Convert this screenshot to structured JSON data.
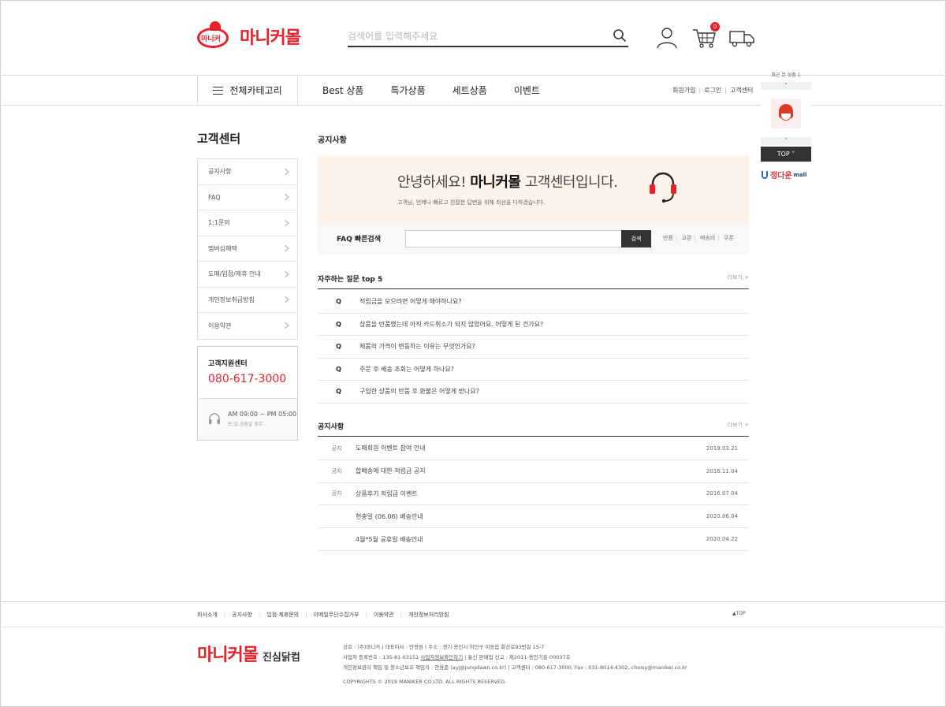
{
  "header": {
    "logo_small": "마니커",
    "logo_text": "마니커몰",
    "search_placeholder": "검색어를 입력해주세요",
    "cart_count": "0"
  },
  "nav": {
    "all_category": "전체카테고리",
    "menu": [
      "Best 상품",
      "특가상품",
      "세트상품",
      "이벤트"
    ],
    "util": [
      "회원가입",
      "로그인",
      "고객센터"
    ]
  },
  "sidebar": {
    "title": "고객센터",
    "items": [
      "공지사항",
      "FAQ",
      "1:1문의",
      "멤버십혜택",
      "도매/입점/제휴 안내",
      "개인정보취급방침",
      "이용약관"
    ],
    "cs_title": "고객지원센터",
    "cs_phone": "080-617-3000",
    "cs_hours": "AM 09:00 ~ PM 05:00",
    "cs_holiday": "토,일,공휴일 휴무"
  },
  "main": {
    "title": "공지사항",
    "banner_prefix": "안녕하세요! ",
    "banner_brand": "마니커몰",
    "banner_suffix": " 고객센터입니다.",
    "banner_desc": "고객님, 언제나 빠르고 친절한 답변을 위해 최선을 다하겠습니다.",
    "faq_search_label": "FAQ 빠른검색",
    "faq_search_button": "검색",
    "faq_tags": [
      "반품",
      "교환",
      "배송비",
      "쿠폰"
    ],
    "faq_section_title": "자주하는 질문 top 5",
    "more_label": "더보기 +",
    "faq_q_mark": "Q",
    "faq_items": [
      "적립금을 모으려면 어떻게 해야하나요?",
      "상품을 반품했는데 아직 카드취소가 되지 않았어요. 어떻게 된 건가요?",
      "제품의 가격이 변동하는 이유는 무엇인가요?",
      "주문 후 배송 조회는 어떻게 하나요?",
      "구입한 상품의 반품 후 환불은 어떻게 받나요?"
    ],
    "notice_section_title": "공지사항",
    "notices": [
      {
        "tag": "공지",
        "title": "도매회원 이벤트 참여 안내",
        "date": "2019.03.21"
      },
      {
        "tag": "공지",
        "title": "합배송에 대한 적립금 공지",
        "date": "2016.11.04"
      },
      {
        "tag": "공지",
        "title": "상품후기 적립금 이벤트",
        "date": "2016.07.04"
      },
      {
        "tag": "",
        "title": "현충일 (06.06) 배송안내",
        "date": "2020.06.04"
      },
      {
        "tag": "",
        "title": "4월*5월 공휴일 배송안내",
        "date": "2020.04.22"
      }
    ]
  },
  "right_float": {
    "recent_label": "최근 본 상품",
    "recent_count": "1",
    "up_arrow": "˄",
    "down_arrow": "˅",
    "top_label": "TOP ˄",
    "banner_brand": "정다운",
    "banner_mall": "mall"
  },
  "footer": {
    "links": [
      "회사소개",
      "공지사항",
      "입점·제휴문의",
      "이메일무단수집거부",
      "이용약관",
      "개인정보처리방침"
    ],
    "top_label": "▲TOP",
    "logo_text": "마니커몰",
    "logo_sub": "진심닭컴",
    "info_line1": "상호 : (주)마니커 | 대표이사 : 안정원 | 주소 : 경기 용인시 처인구 이동읍 화산로93번길 15-7",
    "info_line2_prefix": "사업자 등록번호 : 135-81-03151 ",
    "info_line2_link": "사업자정보확인하기",
    "info_line2_suffix": " | 통신 판매업 신고 : 제2011-용인기흥-00037호",
    "info_line3": "개인정보관리 책임 및 청소년보호 책임자 : 안용준 (ayj@jungdawn.co.kr) | 고객센터 : 080-617-3000, Fax : 031-8014-4302, choisy@maniker.co.kr",
    "copyright": "COPYRIGHTS © 2019 MANIKER CO.LTD. ALL RIGHTS RESERVED."
  },
  "colors": {
    "brand_red": "#e8202a",
    "banner_bg": "#fdf3ea",
    "dark_button": "#333333"
  }
}
